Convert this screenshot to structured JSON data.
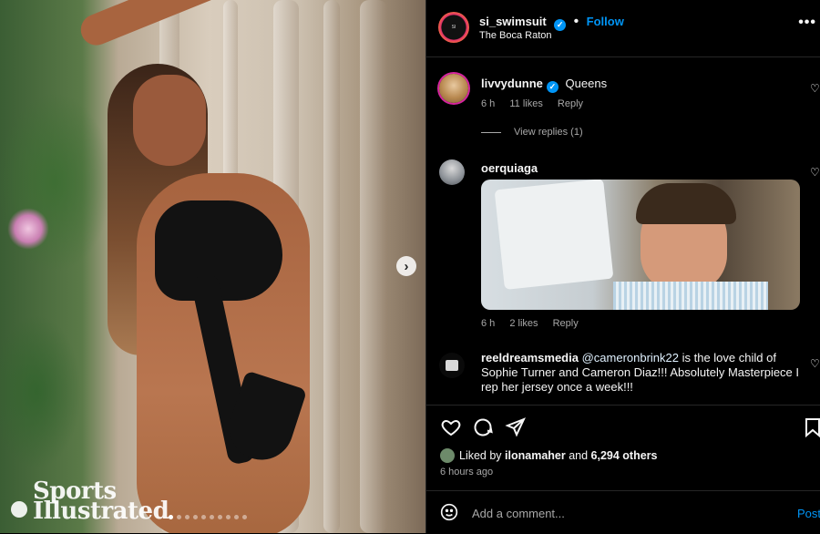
{
  "post": {
    "photo": {
      "watermark": [
        "Sports",
        "Illustrated"
      ],
      "carousel_dots": 10,
      "carousel_active": 0
    },
    "header": {
      "username": "si_swimsuit",
      "follow_label": "Follow",
      "location": "The Boca Raton",
      "separator": "•",
      "more_icon": "more-horizontal-icon"
    },
    "comments": [
      {
        "username": "livvydunne",
        "verified": true,
        "text": "Queens",
        "time": "6 h",
        "likes": "11 likes",
        "reply_label": "Reply",
        "view_replies": "View replies (1)"
      },
      {
        "username": "oerquiaga",
        "text": "",
        "time": "6 h",
        "likes": "2 likes",
        "reply_label": "Reply",
        "has_gif": true
      },
      {
        "username": "reeldreamsmedia",
        "mention": "@cameronbrink22",
        "text": " is the love child of Sophie Turner and Cameron Diaz!!! Absolutely Masterpiece I rep her jersey once a week!!!"
      }
    ],
    "actions": {
      "icons": [
        "heart-icon",
        "comment-icon",
        "share-icon",
        "bookmark-icon"
      ]
    },
    "likes": {
      "prefix": "Liked by ",
      "user": "ilonamaher",
      "and": " and ",
      "count": "6,294 others"
    },
    "time_ago": "6 hours ago",
    "add_comment": {
      "placeholder": "Add a comment...",
      "post_label": "Post"
    },
    "colors": {
      "accent": "#0095f6",
      "background": "#000000",
      "muted": "#a8a8a8"
    }
  }
}
